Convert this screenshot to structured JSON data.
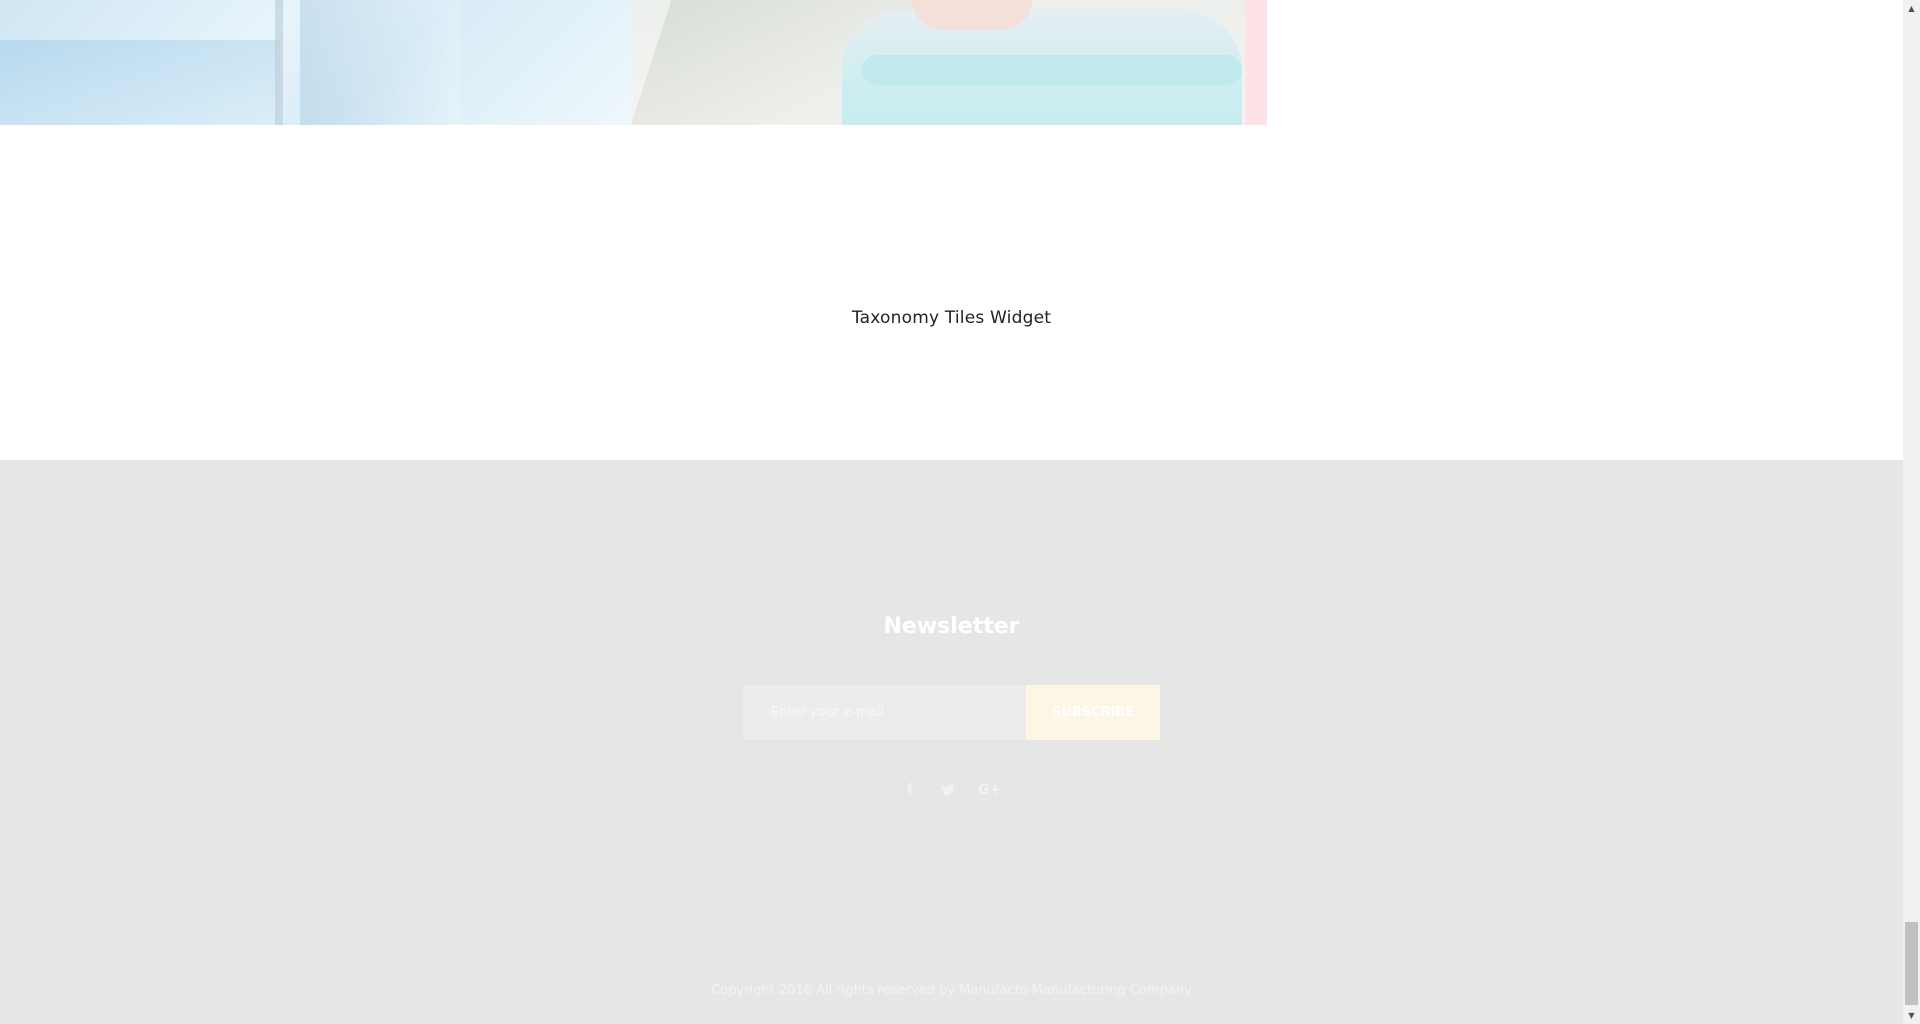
{
  "hero": {
    "images": [
      "hero-image-glass",
      "hero-image-bucket"
    ]
  },
  "taxonomy": {
    "title": "Taxonomy Tiles Widget"
  },
  "newsletter": {
    "title": "Newsletter",
    "email_placeholder": "Enter your e-mail",
    "email_value": "",
    "subscribe_label": "SUBSCRIBE"
  },
  "social": {
    "facebook_glyph": "f",
    "twitter_glyph": "🐦",
    "googleplus_glyph": "G+"
  },
  "footer": {
    "copyright": "Copyright 2016 All rights reserved by Manufacto Manufacturing Company"
  },
  "scrollbar": {
    "up_glyph": "▲",
    "down_glyph": "▼"
  },
  "colors": {
    "footer_bg": "#e6e6e6",
    "subscribe_bg": "#fdf6e4",
    "text_dark": "#222222"
  }
}
